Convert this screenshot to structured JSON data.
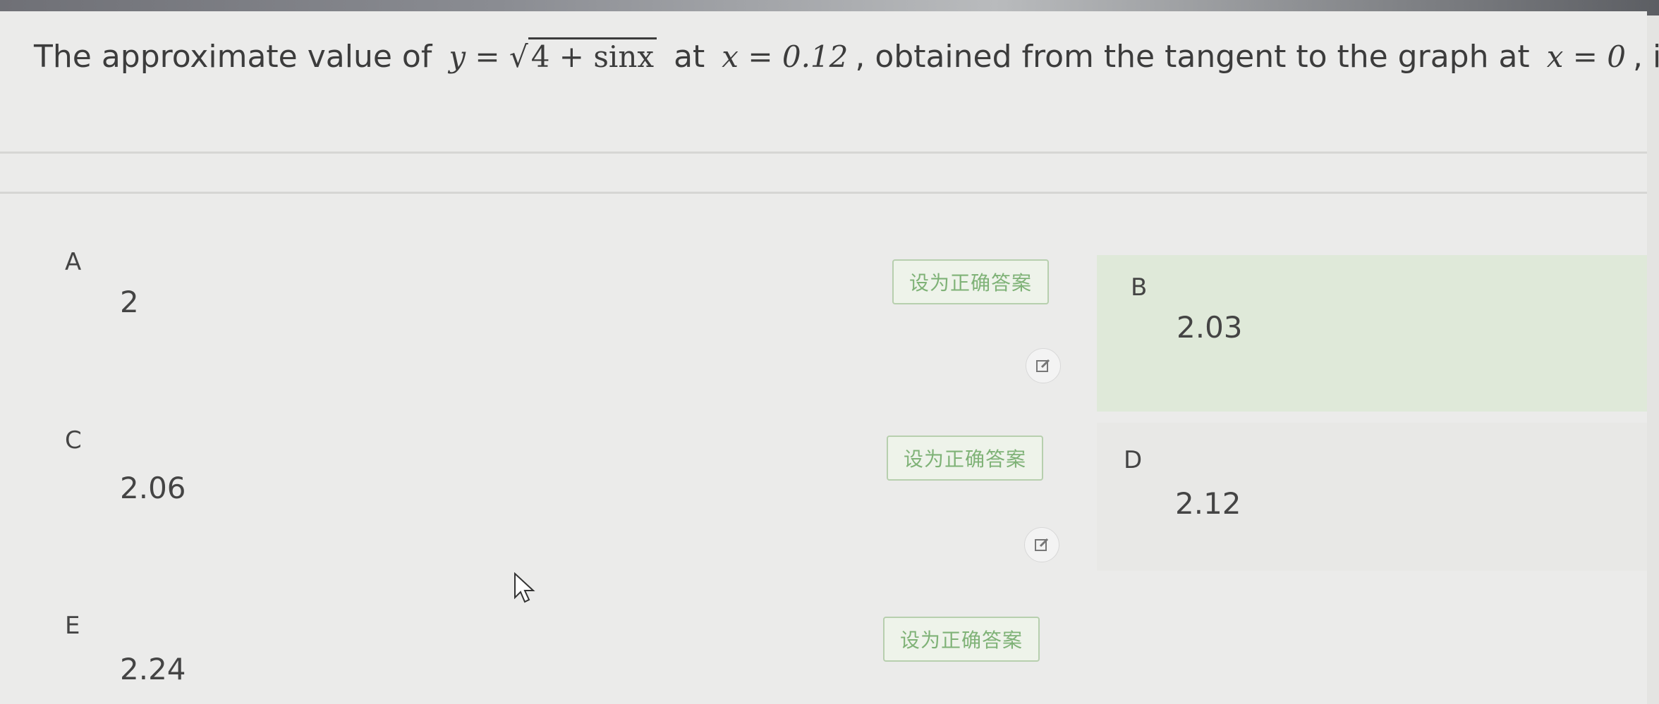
{
  "question": {
    "prefix": "The approximate value of",
    "formula_y": "y =",
    "formula_radicand": "4 + sinx",
    "mid": "at",
    "formula_x1": "x = 0.12",
    "suffix": ", obtained from the tangent to the graph at",
    "formula_x2": "x = 0",
    "end": ", is"
  },
  "options": [
    {
      "letter": "A",
      "value": "2",
      "set_label": "设为正确答案"
    },
    {
      "letter": "B",
      "value": "2.03"
    },
    {
      "letter": "C",
      "value": "2.06",
      "set_label": "设为正确答案"
    },
    {
      "letter": "D",
      "value": "2.12"
    },
    {
      "letter": "E",
      "value": "2.24",
      "set_label": "设为正确答案"
    }
  ],
  "icons": {
    "edit": "edit-icon",
    "cursor": "mouse-cursor-icon"
  },
  "colors": {
    "accent_green": "#7fb277",
    "highlight_bg": "#dfe9d9"
  }
}
